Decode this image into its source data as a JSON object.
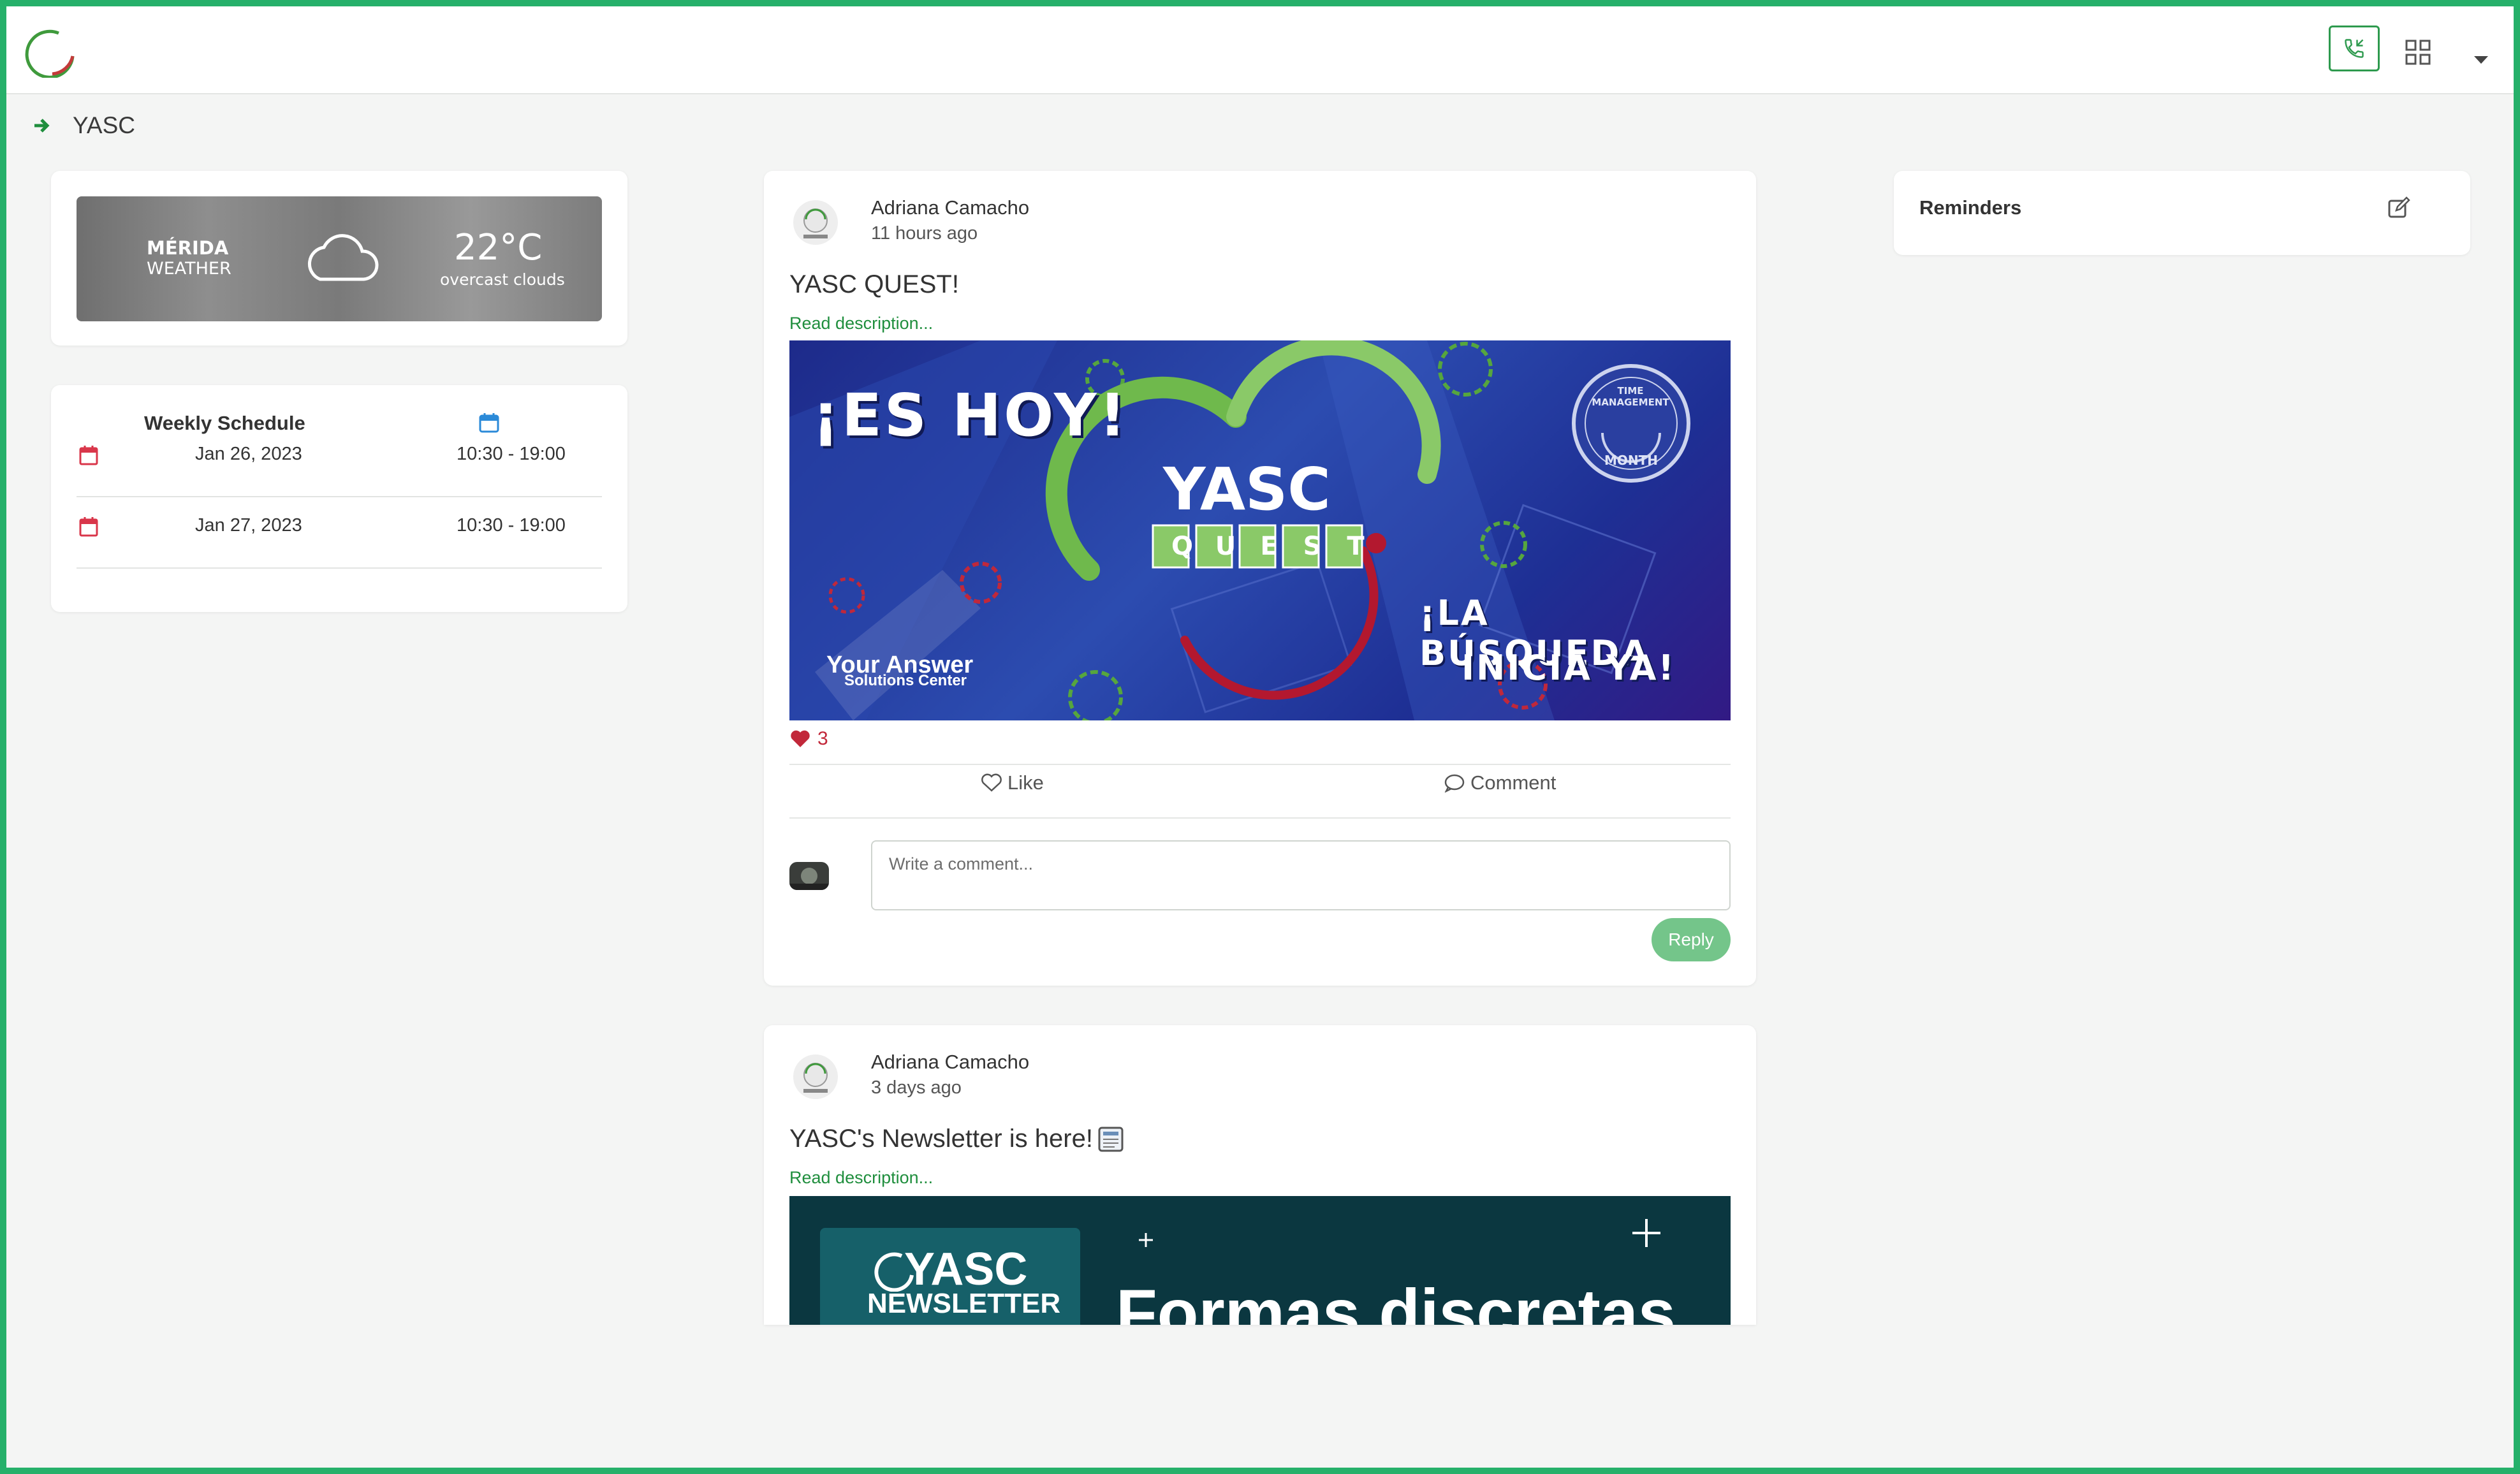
{
  "brand": {
    "accent": "#26b06a",
    "primary_green": "#2e9a4e",
    "like_red": "#c2283a"
  },
  "topbar": {
    "call_icon": "phone-icon",
    "apps_icon": "grid-icon",
    "menu_icon": "caret-down-icon"
  },
  "breadcrumb": {
    "current": "YASC"
  },
  "weather": {
    "city": "MÉRIDA",
    "label": "WEATHER",
    "temp": "22°C",
    "desc": "overcast clouds",
    "icon": "cloud-icon"
  },
  "schedule": {
    "title": "Weekly Schedule",
    "rows": [
      {
        "date": "Jan 26, 2023",
        "time": "10:30 - 19:00"
      },
      {
        "date": "Jan 27, 2023",
        "time": "10:30 - 19:00"
      }
    ]
  },
  "posts": [
    {
      "author": "Adriana Camacho",
      "time_ago": "11 hours ago",
      "title": "YASC QUEST!",
      "read_more": "Read description...",
      "banner": {
        "headline": "¡ES HOY!",
        "brand_big": "YASC",
        "brand_letters": [
          "Q",
          "U",
          "E",
          "S",
          "T"
        ],
        "badge_top": "TIME MANAGEMENT",
        "badge_bottom": "MONTH",
        "tagline_1": "¡LA BÚSQUEDA",
        "tagline_2": "INICIA YA!",
        "company_1": "Your Answer",
        "company_2": "Solutions Center"
      },
      "likes": "3",
      "like_label": "Like",
      "comment_label": "Comment",
      "comment_placeholder": "Write a comment...",
      "reply_label": "Reply"
    },
    {
      "author": "Adriana Camacho",
      "time_ago": "3 days ago",
      "title": "YASC's Newsletter is here!",
      "read_more": "Read description...",
      "banner": {
        "logo_1": "YASC",
        "logo_2": "NEWSLETTER",
        "headline": "Formas discretas"
      }
    }
  ],
  "reminders": {
    "title": "Reminders"
  }
}
